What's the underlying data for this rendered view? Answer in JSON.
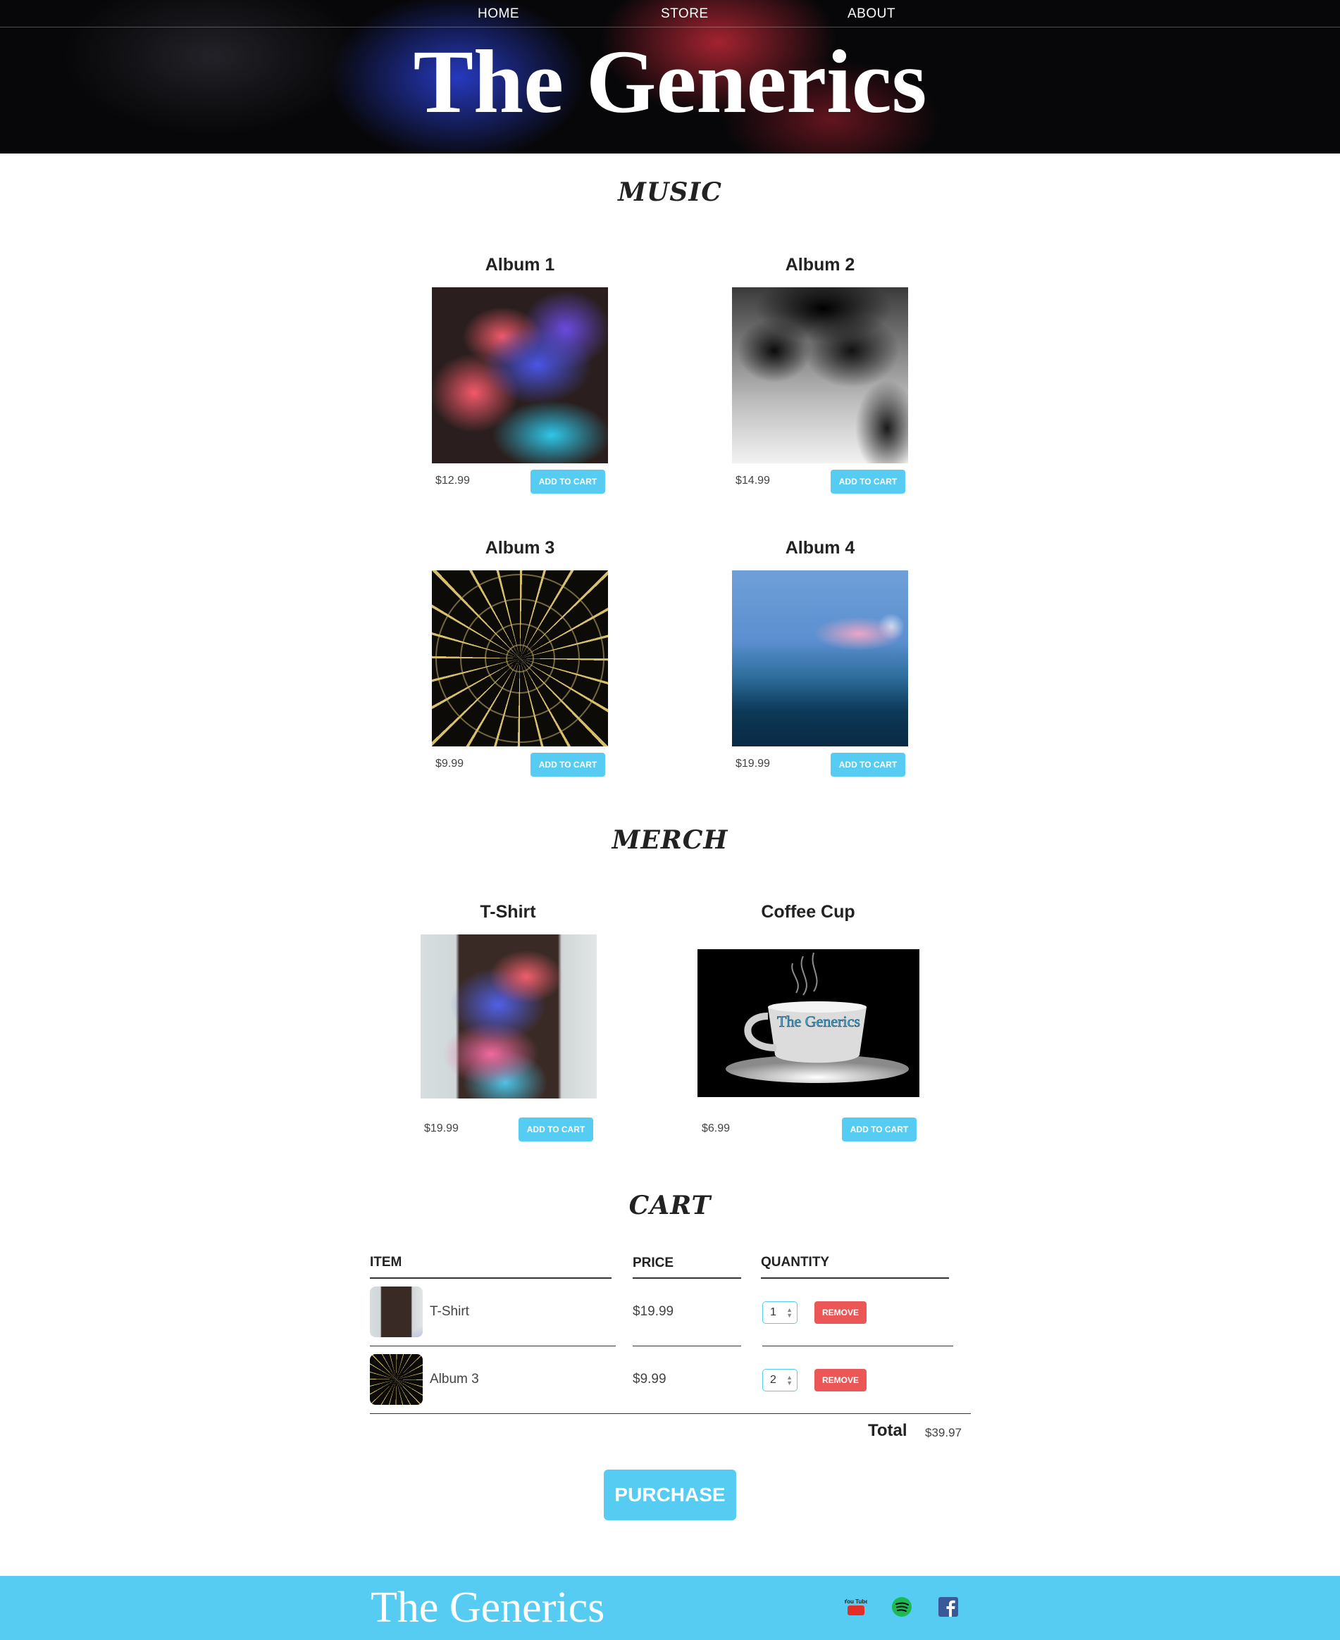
{
  "nav": {
    "home": "HOME",
    "store": "STORE",
    "about": "ABOUT"
  },
  "band_title": "The Generics",
  "sections": {
    "music": "MUSIC",
    "merch": "MERCH",
    "cart": "CART"
  },
  "albums": [
    {
      "title": "Album 1",
      "price": "$12.99",
      "add_label": "ADD TO CART"
    },
    {
      "title": "Album 2",
      "price": "$14.99",
      "add_label": "ADD TO CART"
    },
    {
      "title": "Album 3",
      "price": "$9.99",
      "add_label": "ADD TO CART"
    },
    {
      "title": "Album 4",
      "price": "$19.99",
      "add_label": "ADD TO CART"
    }
  ],
  "merch": [
    {
      "title": "T-Shirt",
      "price": "$19.99",
      "add_label": "ADD TO CART"
    },
    {
      "title": "Coffee Cup",
      "price": "$6.99",
      "add_label": "ADD TO CART",
      "cup_text": "The Generics"
    }
  ],
  "cart": {
    "headers": {
      "item": "ITEM",
      "price": "PRICE",
      "quantity": "QUANTITY"
    },
    "rows": [
      {
        "name": "T-Shirt",
        "price": "$19.99",
        "quantity": "1",
        "remove_label": "REMOVE"
      },
      {
        "name": "Album 3",
        "price": "$9.99",
        "quantity": "2",
        "remove_label": "REMOVE"
      }
    ],
    "total_label": "Total",
    "total_value": "$39.97"
  },
  "purchase_label": "PURCHASE",
  "footer": {
    "title": "The Generics",
    "icons": [
      "youtube-icon",
      "spotify-icon",
      "facebook-icon"
    ],
    "youtube_text": "You Tube"
  },
  "colors": {
    "accent": "#56CCF2",
    "danger": "#EB5757",
    "header_bg": "#070709"
  }
}
